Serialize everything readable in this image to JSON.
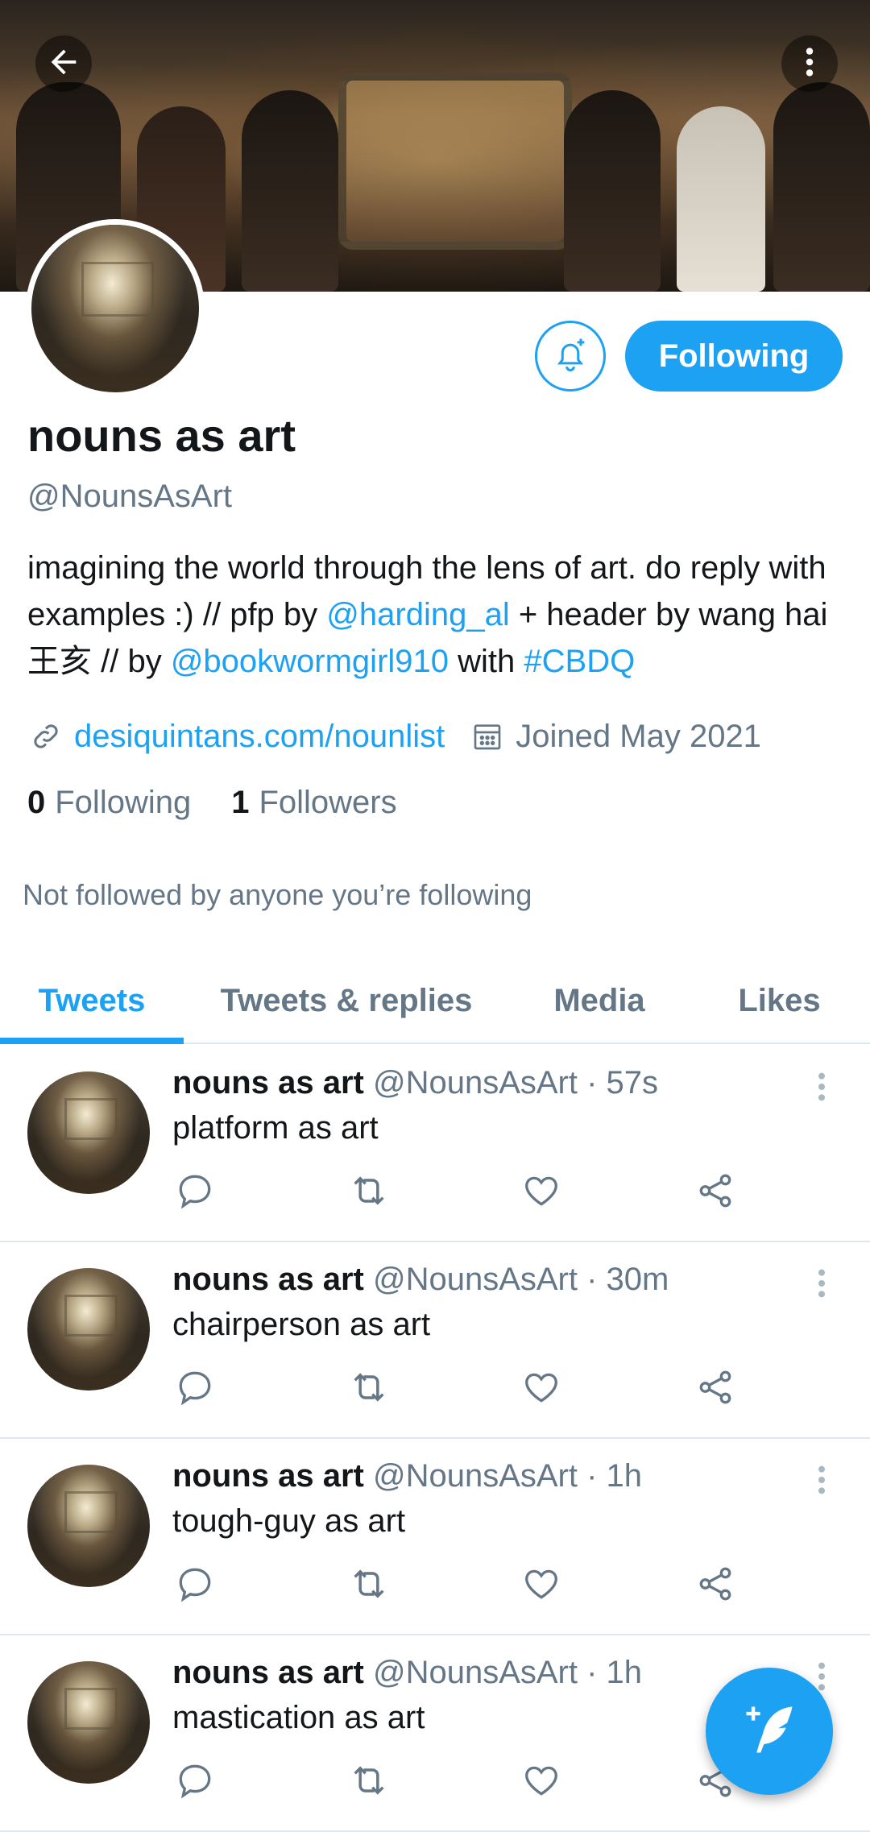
{
  "header": {
    "back_icon": "arrow-left-icon",
    "more_icon": "more-vertical-icon"
  },
  "profile": {
    "display_name": "nouns as art",
    "handle": "@NounsAsArt",
    "bio": {
      "part1": "imagining the world through the lens of art. do reply with examples :) // pfp by ",
      "mention1": "@harding_al",
      "part2": " + header by wang hai 王亥 // by ",
      "mention2": "@bookwormgirl910",
      "part3": " with ",
      "hashtag": "#CBDQ"
    },
    "website": "desiquintans.com/nounlist",
    "joined": "Joined May 2021",
    "following_count": "0",
    "following_label": "Following",
    "followers_count": "1",
    "followers_label": "Followers",
    "not_followed_text": "Not followed by anyone you’re following",
    "notify_icon": "bell-plus-icon",
    "follow_button_label": "Following",
    "accent_color": "#1da1f2"
  },
  "tabs": [
    {
      "label": "Tweets",
      "active": true
    },
    {
      "label": "Tweets & replies",
      "active": false
    },
    {
      "label": "Media",
      "active": false
    },
    {
      "label": "Likes",
      "active": false
    }
  ],
  "tweets": [
    {
      "name": "nouns as art",
      "handle_time": "@NounsAsArt · 57s",
      "text": "platform as art"
    },
    {
      "name": "nouns as art",
      "handle_time": "@NounsAsArt · 30m",
      "text": "chairperson as art"
    },
    {
      "name": "nouns as art",
      "handle_time": "@NounsAsArt · 1h",
      "text": "tough-guy as art"
    },
    {
      "name": "nouns as art",
      "handle_time": "@NounsAsArt · 1h",
      "text": "mastication as art"
    }
  ],
  "actions": [
    "reply-icon",
    "retweet-icon",
    "like-icon",
    "share-icon"
  ],
  "compose_icon": "compose-tweet-icon"
}
